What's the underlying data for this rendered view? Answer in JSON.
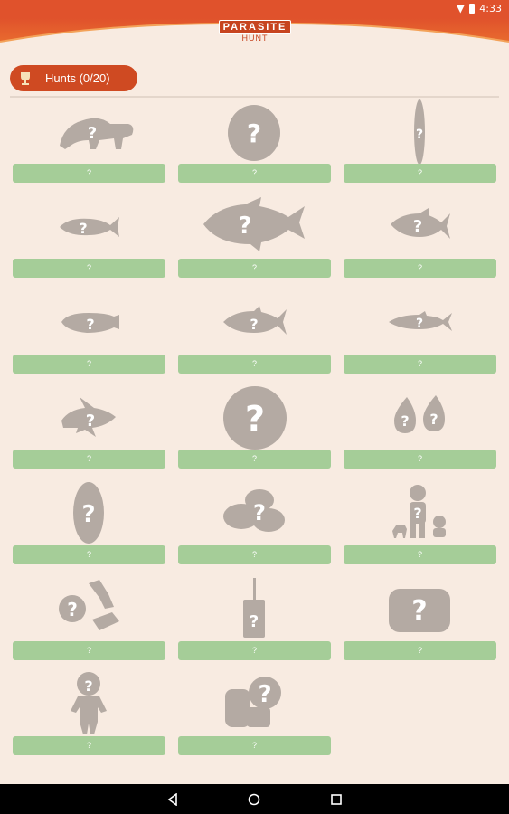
{
  "status_bar": {
    "time": "4:33"
  },
  "header": {
    "logo_line1": "PARASITE",
    "logo_line2": "HUNT"
  },
  "hunts": {
    "label": "Hunts (0/20)"
  },
  "colors": {
    "accent": "#cf4a22",
    "background": "#f8ebe1",
    "tile_bar": "#a5cd98",
    "silhouette": "#b4aaa3"
  },
  "tiles": [
    {
      "icon": "anteater-silhouette-icon",
      "label": "?"
    },
    {
      "icon": "oval-silhouette-icon",
      "label": "?"
    },
    {
      "icon": "long-worm-silhouette-icon",
      "label": "?"
    },
    {
      "icon": "small-fish-silhouette-icon",
      "label": "?"
    },
    {
      "icon": "large-fish-silhouette-icon",
      "label": "?"
    },
    {
      "icon": "fish-silhouette-icon",
      "label": "?"
    },
    {
      "icon": "flat-fish-silhouette-icon",
      "label": "?"
    },
    {
      "icon": "trout-silhouette-icon",
      "label": "?"
    },
    {
      "icon": "slim-fish-silhouette-icon",
      "label": "?"
    },
    {
      "icon": "spiky-fish-silhouette-icon",
      "label": "?"
    },
    {
      "icon": "circle-silhouette-icon",
      "label": "?"
    },
    {
      "icon": "seeds-silhouette-icon",
      "label": "?"
    },
    {
      "icon": "egg-silhouette-icon",
      "label": "?"
    },
    {
      "icon": "blobs-silhouette-icon",
      "label": "?"
    },
    {
      "icon": "people-pets-silhouette-icon",
      "label": "?"
    },
    {
      "icon": "snails-silhouette-icon",
      "label": "?"
    },
    {
      "icon": "vial-silhouette-icon",
      "label": "?"
    },
    {
      "icon": "rounded-rectangle-silhouette-icon",
      "label": "?"
    },
    {
      "icon": "child-silhouette-icon",
      "label": "?"
    },
    {
      "icon": "heads-silhouette-icon",
      "label": "?"
    }
  ]
}
